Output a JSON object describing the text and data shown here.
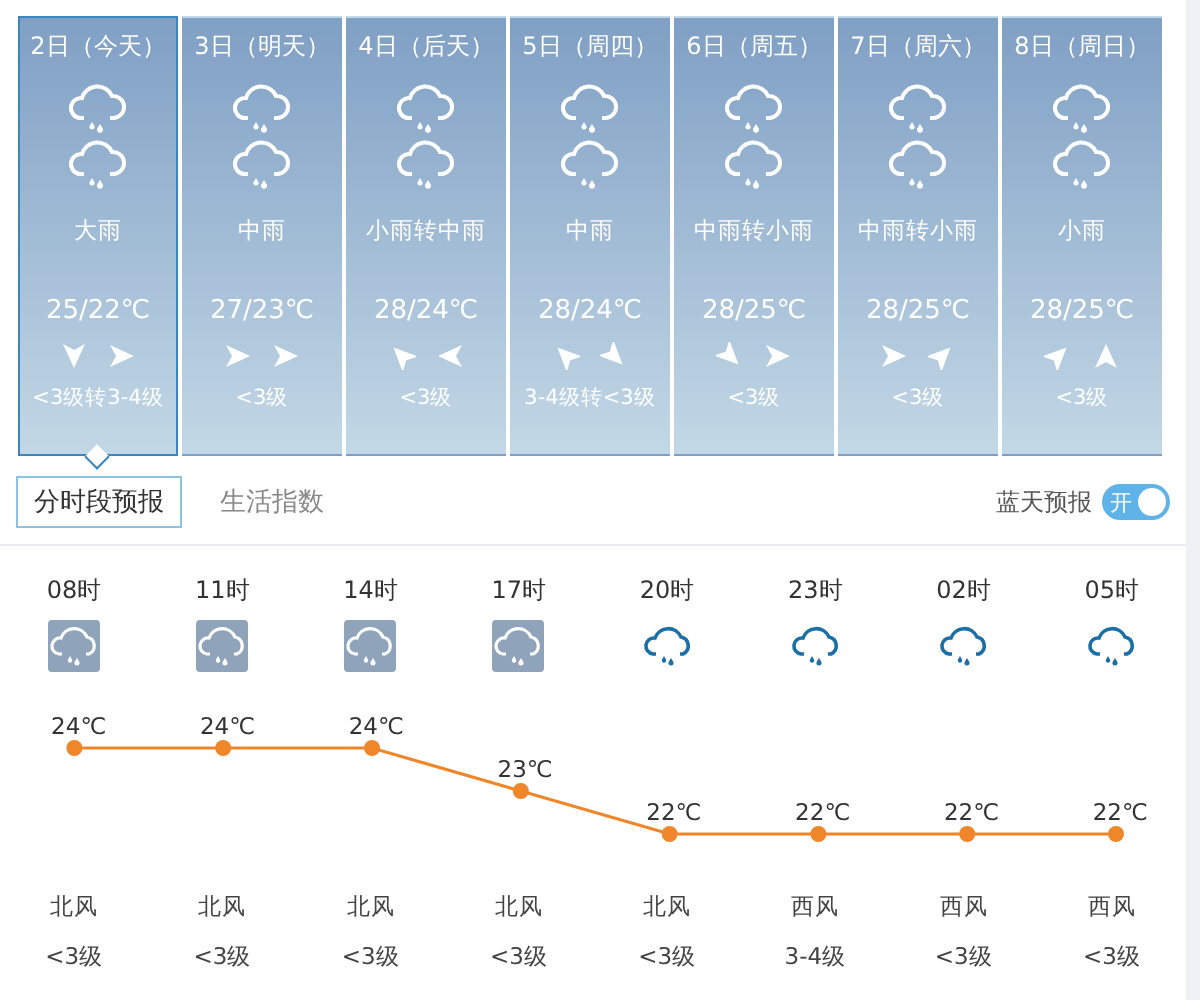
{
  "days": [
    {
      "date": "2日（今天）",
      "weather": "大雨",
      "temp": "25/22℃",
      "wind_arrows": [
        {
          "kind": "down"
        },
        {
          "kind": "right"
        }
      ],
      "wind": "<3级转3-4级",
      "selected": true
    },
    {
      "date": "3日（明天）",
      "weather": "中雨",
      "temp": "27/23℃",
      "wind_arrows": [
        {
          "kind": "right"
        },
        {
          "kind": "right"
        }
      ],
      "wind": "<3级",
      "selected": false
    },
    {
      "date": "4日（后天）",
      "weather": "小雨转中雨",
      "temp": "28/24℃",
      "wind_arrows": [
        {
          "kind": "up-left"
        },
        {
          "kind": "left"
        }
      ],
      "wind": "<3级",
      "selected": false
    },
    {
      "date": "5日（周四）",
      "weather": "中雨",
      "temp": "28/24℃",
      "wind_arrows": [
        {
          "kind": "up-left"
        },
        {
          "kind": "down-right"
        }
      ],
      "wind": "3-4级转<3级",
      "selected": false
    },
    {
      "date": "6日（周五）",
      "weather": "中雨转小雨",
      "temp": "28/25℃",
      "wind_arrows": [
        {
          "kind": "down-right"
        },
        {
          "kind": "right"
        }
      ],
      "wind": "<3级",
      "selected": false
    },
    {
      "date": "7日（周六）",
      "weather": "中雨转小雨",
      "temp": "28/25℃",
      "wind_arrows": [
        {
          "kind": "right"
        },
        {
          "kind": "up-right"
        }
      ],
      "wind": "<3级",
      "selected": false
    },
    {
      "date": "8日（周日）",
      "weather": "小雨",
      "temp": "28/25℃",
      "wind_arrows": [
        {
          "kind": "up-right"
        },
        {
          "kind": "up"
        }
      ],
      "wind": "<3级",
      "selected": false
    }
  ],
  "tabs": [
    {
      "label": "分时段预报",
      "selected": true
    },
    {
      "label": "生活指数",
      "selected": false
    }
  ],
  "blue_sky_forecast": {
    "label": "蓝天预报",
    "on": true,
    "switch_text": "开"
  },
  "hourly": {
    "hours": [
      {
        "time": "08时",
        "kind": "boxed",
        "wind": "北风",
        "level_text": "<3级"
      },
      {
        "time": "11时",
        "kind": "boxed",
        "wind": "北风",
        "level_text": "<3级"
      },
      {
        "time": "14时",
        "kind": "boxed",
        "wind": "北风",
        "level_text": "<3级"
      },
      {
        "time": "17时",
        "kind": "boxed",
        "wind": "北风",
        "level_text": "<3级"
      },
      {
        "time": "20时",
        "kind": "plain",
        "wind": "北风",
        "level_text": "<3级"
      },
      {
        "time": "23时",
        "kind": "plain",
        "wind": "西风",
        "level_text": "3-4级"
      },
      {
        "time": "02时",
        "kind": "plain",
        "wind": "西风",
        "level_text": "<3级"
      },
      {
        "time": "05时",
        "kind": "plain",
        "wind": "西风",
        "level_text": "<3级"
      }
    ],
    "chart_data": {
      "type": "line",
      "series": [
        {
          "color": "#f0862a",
          "marker": "circle",
          "values": [
            24,
            24,
            24,
            23,
            22,
            22,
            22,
            22
          ]
        }
      ],
      "data_labels": true
    },
    "temperature_unit": "℃"
  }
}
